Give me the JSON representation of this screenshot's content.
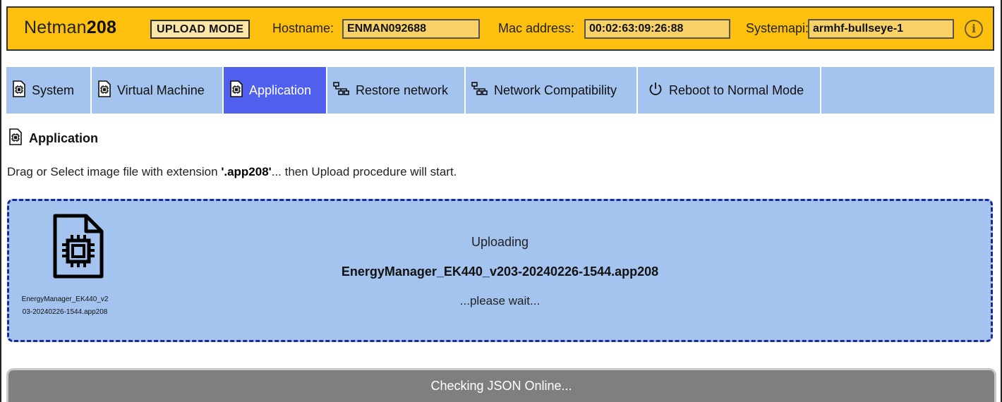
{
  "header": {
    "brand_light": "Netman",
    "brand_bold": "208",
    "mode": "UPLOAD MODE",
    "hostname_label": "Hostname:",
    "hostname": "ENMAN092688",
    "mac_label": "Mac address:",
    "mac": "00:02:63:09:26:88",
    "systemapi_label": "Systemapi:",
    "systemapi": "armhf-bullseye-1",
    "info_icon": "info-icon",
    "color": "#fec00f"
  },
  "tabs": [
    {
      "label": "System",
      "icon": "chip-file-icon"
    },
    {
      "label": "Virtual Machine",
      "icon": "chip-file-icon"
    },
    {
      "label": "Application",
      "icon": "chip-file-icon",
      "active": true
    },
    {
      "label": "Restore network",
      "icon": "network-icon"
    },
    {
      "label": "Network Compatibility",
      "icon": "network-icon"
    },
    {
      "label": "Reboot to Normal Mode",
      "icon": "power-icon"
    }
  ],
  "section": {
    "title": "Application",
    "instruction_pre": "Drag or Select image file with extension ",
    "instruction_ext": "'.app208'",
    "instruction_post": "... then Upload procedure will start."
  },
  "dropzone": {
    "file_icon": "chip-file-icon",
    "file_name_line1": "EnergyManager_EK440_v2",
    "file_name_line2": "03-20240226-1544.app208",
    "status": "Uploading",
    "file_name": "EnergyManager_EK440_v203-20240226-1544.app208",
    "wait": "...please wait..."
  },
  "status_bar": {
    "text": "Checking JSON Online..."
  },
  "colors": {
    "accent_tab": "#4f60ef",
    "tab_bg": "#a4c4ef",
    "dropzone_border": "#1a2b99",
    "status_bar": "#7f7f7f"
  }
}
